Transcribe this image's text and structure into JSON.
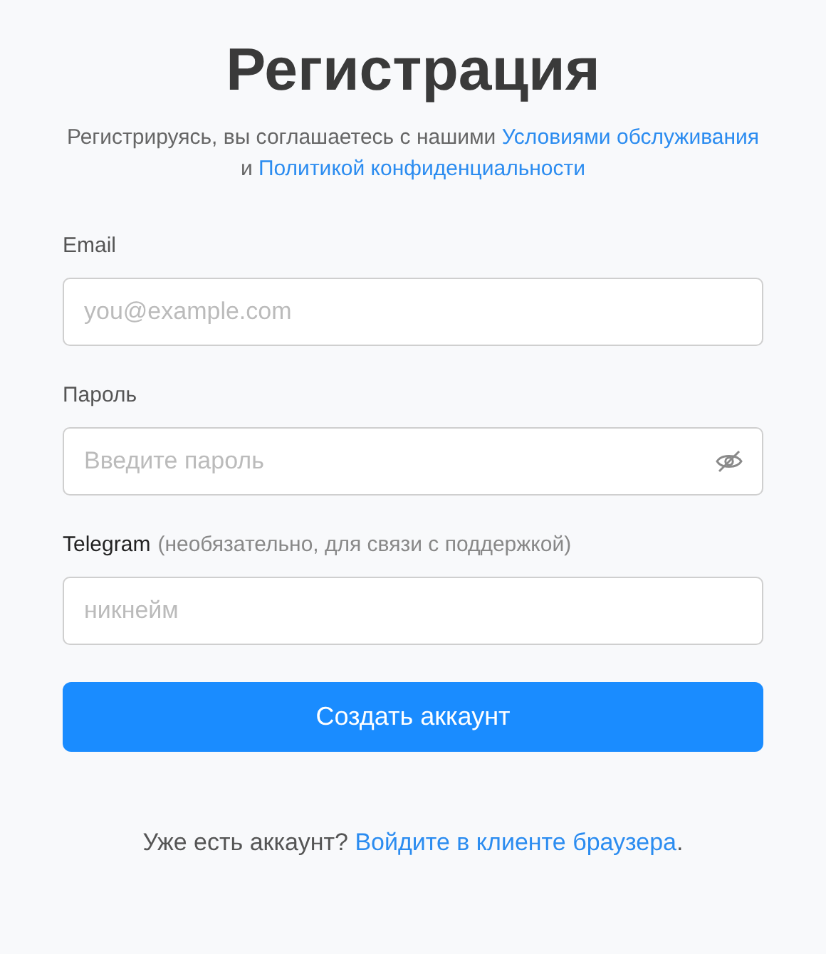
{
  "title": "Регистрация",
  "intro": [
    {
      "kind": "text",
      "text": "Регистрируясь, вы соглашаетесь с нашими "
    },
    {
      "kind": "link",
      "text": "Условиями обслуживания"
    },
    {
      "kind": "text",
      "text": " и "
    },
    {
      "kind": "link",
      "text": "Политикой конфиденциальности"
    }
  ],
  "fields": [
    {
      "label": "Email",
      "placeholder": "you@example.com",
      "kind": "email"
    },
    {
      "label": "Пароль",
      "placeholder": "Введите пароль",
      "kind": "password"
    },
    {
      "label": "Telegram",
      "hint": "(необязательно, для связи с поддержкой)",
      "placeholder": "никнейм",
      "kind": "text"
    }
  ],
  "submit": "Создать аккаунт",
  "footer": [
    {
      "kind": "text",
      "text": "Уже есть аккаунт? "
    },
    {
      "kind": "link",
      "text": "Войдите в клиенте браузера"
    },
    {
      "kind": "text",
      "text": "."
    }
  ]
}
